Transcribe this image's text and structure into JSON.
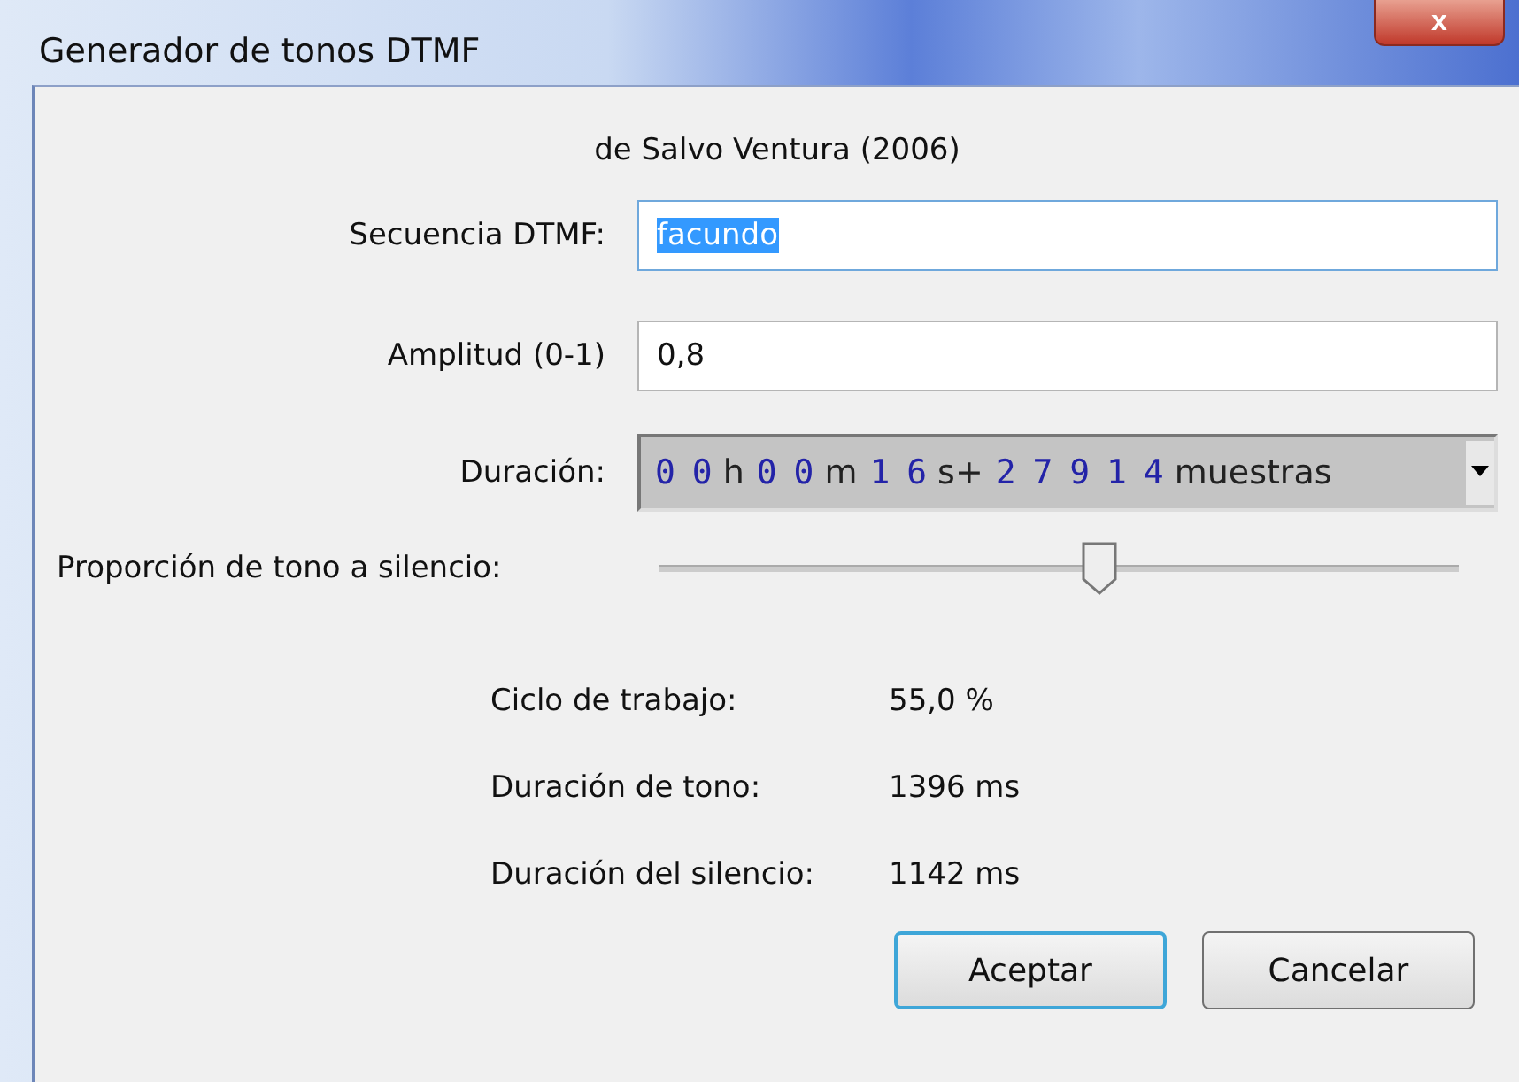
{
  "window": {
    "title": "Generador de tonos DTMF",
    "close_label": "x"
  },
  "subtitle": "de Salvo Ventura (2006)",
  "fields": [
    {
      "label": "Secuencia DTMF:",
      "value": "facundo",
      "text_selected": true,
      "focused": true
    },
    {
      "label": "Amplitud (0-1)",
      "value": "0,8",
      "text_selected": false,
      "focused": false
    }
  ],
  "duration": {
    "label": "Duración:",
    "segments": [
      {
        "kind": "digits",
        "text": "0 0"
      },
      {
        "kind": "unit",
        "text": "h"
      },
      {
        "kind": "digits",
        "text": "0 0"
      },
      {
        "kind": "unit",
        "text": "m"
      },
      {
        "kind": "digits",
        "text": "1 6"
      },
      {
        "kind": "unit",
        "text": "s+"
      },
      {
        "kind": "digits",
        "text": "2 7 9 1 4"
      },
      {
        "kind": "unit",
        "text": "muestras"
      }
    ]
  },
  "slider": {
    "label": "Proporción de tono a silencio:",
    "level": 0.55
  },
  "results": [
    {
      "label": "Ciclo de trabajo:",
      "value": "55,0 %"
    },
    {
      "label": "Duración de tono:",
      "value": "1396 ms"
    },
    {
      "label": "Duración del silencio:",
      "value": "1142 ms"
    }
  ],
  "buttons": [
    {
      "label": "Aceptar",
      "default": true
    },
    {
      "label": "Cancelar",
      "default": false
    }
  ]
}
